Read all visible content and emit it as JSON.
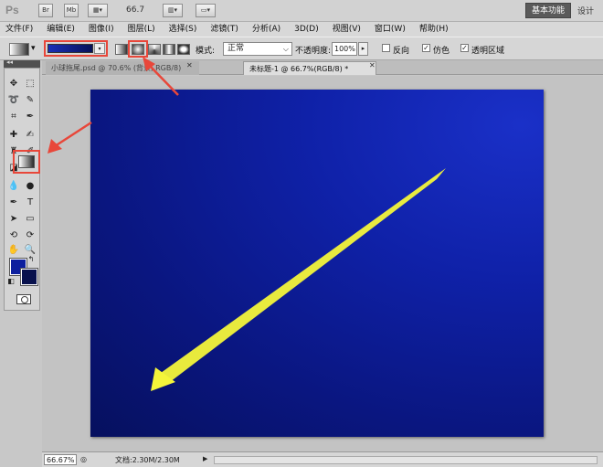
{
  "app": {
    "logo": "Ps",
    "buttons": [
      "Br",
      "Mb"
    ],
    "zoom": "66.7",
    "workspace_active": "基本功能",
    "workspace_other": "设计"
  },
  "menu": [
    "文件(F)",
    "编辑(E)",
    "图像(I)",
    "图层(L)",
    "选择(S)",
    "滤镜(T)",
    "分析(A)",
    "3D(D)",
    "视图(V)",
    "窗口(W)",
    "帮助(H)"
  ],
  "options": {
    "mode_label": "模式:",
    "mode_value": "正常",
    "opacity_label": "不透明度:",
    "opacity_value": "100%",
    "reverse_label": "反向",
    "dither_label": "仿色",
    "transparency_label": "透明区域",
    "reverse_checked": false,
    "dither_checked": true,
    "transparency_checked": true
  },
  "tabs": [
    {
      "label": "小球拖尾.psd @ 70.6% (背景, RGB/8)"
    },
    {
      "label": "未标题-1 @ 66.7%(RGB/8) *"
    }
  ],
  "colors": {
    "foreground": "#0d1f9e",
    "background": "#08114d",
    "annotation": "#e8473a",
    "arrow": "#f4f53a"
  },
  "status": {
    "zoom": "66.67%",
    "doc_info": "文档:2.30M/2.30M"
  }
}
